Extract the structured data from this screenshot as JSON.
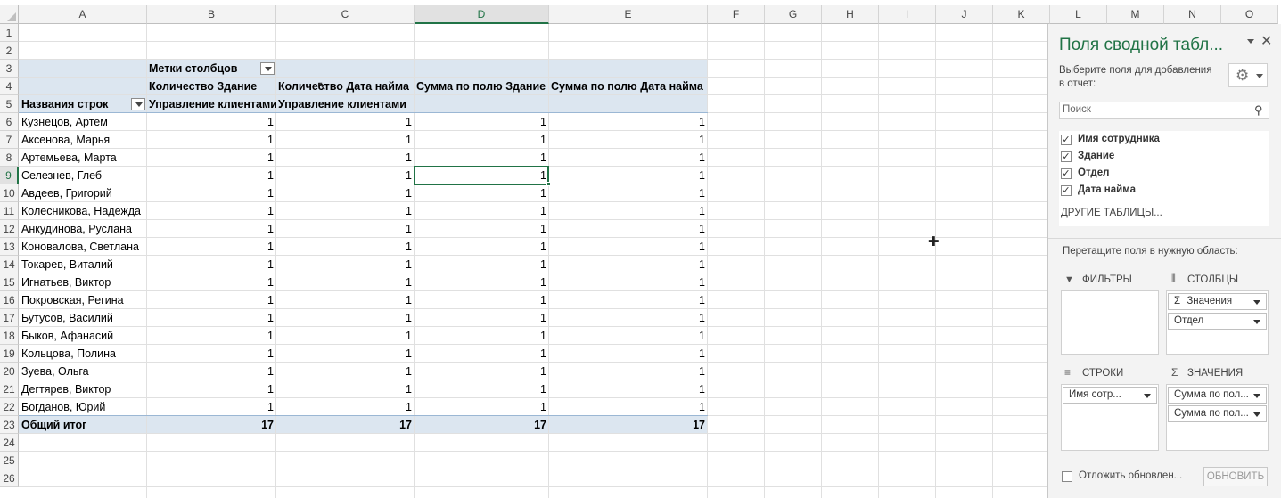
{
  "columns": [
    "A",
    "B",
    "C",
    "D",
    "E",
    "F",
    "G",
    "H",
    "I",
    "J",
    "K",
    "L",
    "M",
    "N",
    "O"
  ],
  "rows": [
    "1",
    "2",
    "3",
    "4",
    "5",
    "6",
    "7",
    "8",
    "9",
    "10",
    "11",
    "12",
    "13",
    "14",
    "15",
    "16",
    "17",
    "18",
    "19",
    "20",
    "21",
    "22",
    "23",
    "24",
    "25",
    "26"
  ],
  "pivot": {
    "col_labels": "Метки столбцов",
    "row_labels": "Названия строк",
    "headers_r4": [
      "Количество Здание",
      "Количество Дата найма",
      "Сумма по полю Здание",
      "Сумма по полю Дата найма"
    ],
    "headers_r5": [
      "Управление клиентами",
      "Управление клиентами"
    ],
    "names": [
      "Кузнецов, Артем",
      "Аксенова, Марья",
      "Артемьева, Марта",
      "Селезнев, Глеб",
      "Авдеев, Григорий",
      "Колесникова, Надежда",
      "Анкудинова, Руслана",
      "Коновалова, Светлана",
      "Токарев, Виталий",
      "Игнатьев, Виктор",
      "Покровская, Регина",
      "Бутусов, Василий",
      "Быков, Афанасий",
      "Кольцова, Полина",
      "Зуева, Ольга",
      "Дегтярев, Виктор",
      "Богданов, Юрий"
    ],
    "value": "1",
    "total_label": "Общий итог",
    "totals": [
      "17",
      "17",
      "17",
      "17"
    ]
  },
  "pane": {
    "title": "Поля сводной табл...",
    "choose_text": "Выберите поля для добавления в отчет:",
    "search_placeholder": "Поиск",
    "fields": [
      "Имя сотрудника",
      "Здание",
      "Отдел",
      "Дата найма"
    ],
    "more_tables": "ДРУГИЕ ТАБЛИЦЫ...",
    "drag_text": "Перетащите поля в нужную область:",
    "filters_label": "ФИЛЬТРЫ",
    "columns_label": "СТОЛБЦЫ",
    "rows_label": "СТРОКИ",
    "values_label": "ЗНАЧЕНИЯ",
    "columns_items": [
      "Значения",
      "Отдел"
    ],
    "rows_items": [
      "Имя сотр..."
    ],
    "values_items": [
      "Сумма по пол...",
      "Сумма по пол..."
    ],
    "defer_label": "Отложить обновлен...",
    "update_button": "ОБНОВИТЬ",
    "sigma": "Σ"
  }
}
